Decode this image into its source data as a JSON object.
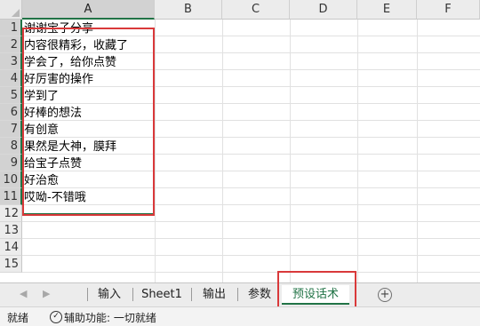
{
  "columns": [
    "A",
    "B",
    "C",
    "D",
    "E",
    "F"
  ],
  "selected_column": "A",
  "rows": [
    "1",
    "2",
    "3",
    "4",
    "5",
    "6",
    "7",
    "8",
    "9",
    "10",
    "11",
    "12",
    "13",
    "14",
    "15"
  ],
  "cells_A": [
    "谢谢宝子分享",
    "内容很精彩，收藏了",
    "学会了，给你点赞",
    "好厉害的操作",
    "学到了",
    "好棒的想法",
    "有创意",
    "果然是大神，膜拜",
    "给宝子点赞",
    "好治愈",
    "哎呦-不错哦"
  ],
  "sheet_tabs": {
    "tabs": [
      "输入",
      "Sheet1",
      "输出",
      "参数",
      "预设话术"
    ],
    "active": "预设话术",
    "prev_icon": "nav-prev-icon",
    "next_icon": "nav-next-icon",
    "add_icon": "add-sheet-icon"
  },
  "status_bar": {
    "ready": "就绪",
    "accessibility": "辅助功能: 一切就绪"
  },
  "colors": {
    "accent": "#217346",
    "highlight_box": "#d9393a"
  }
}
